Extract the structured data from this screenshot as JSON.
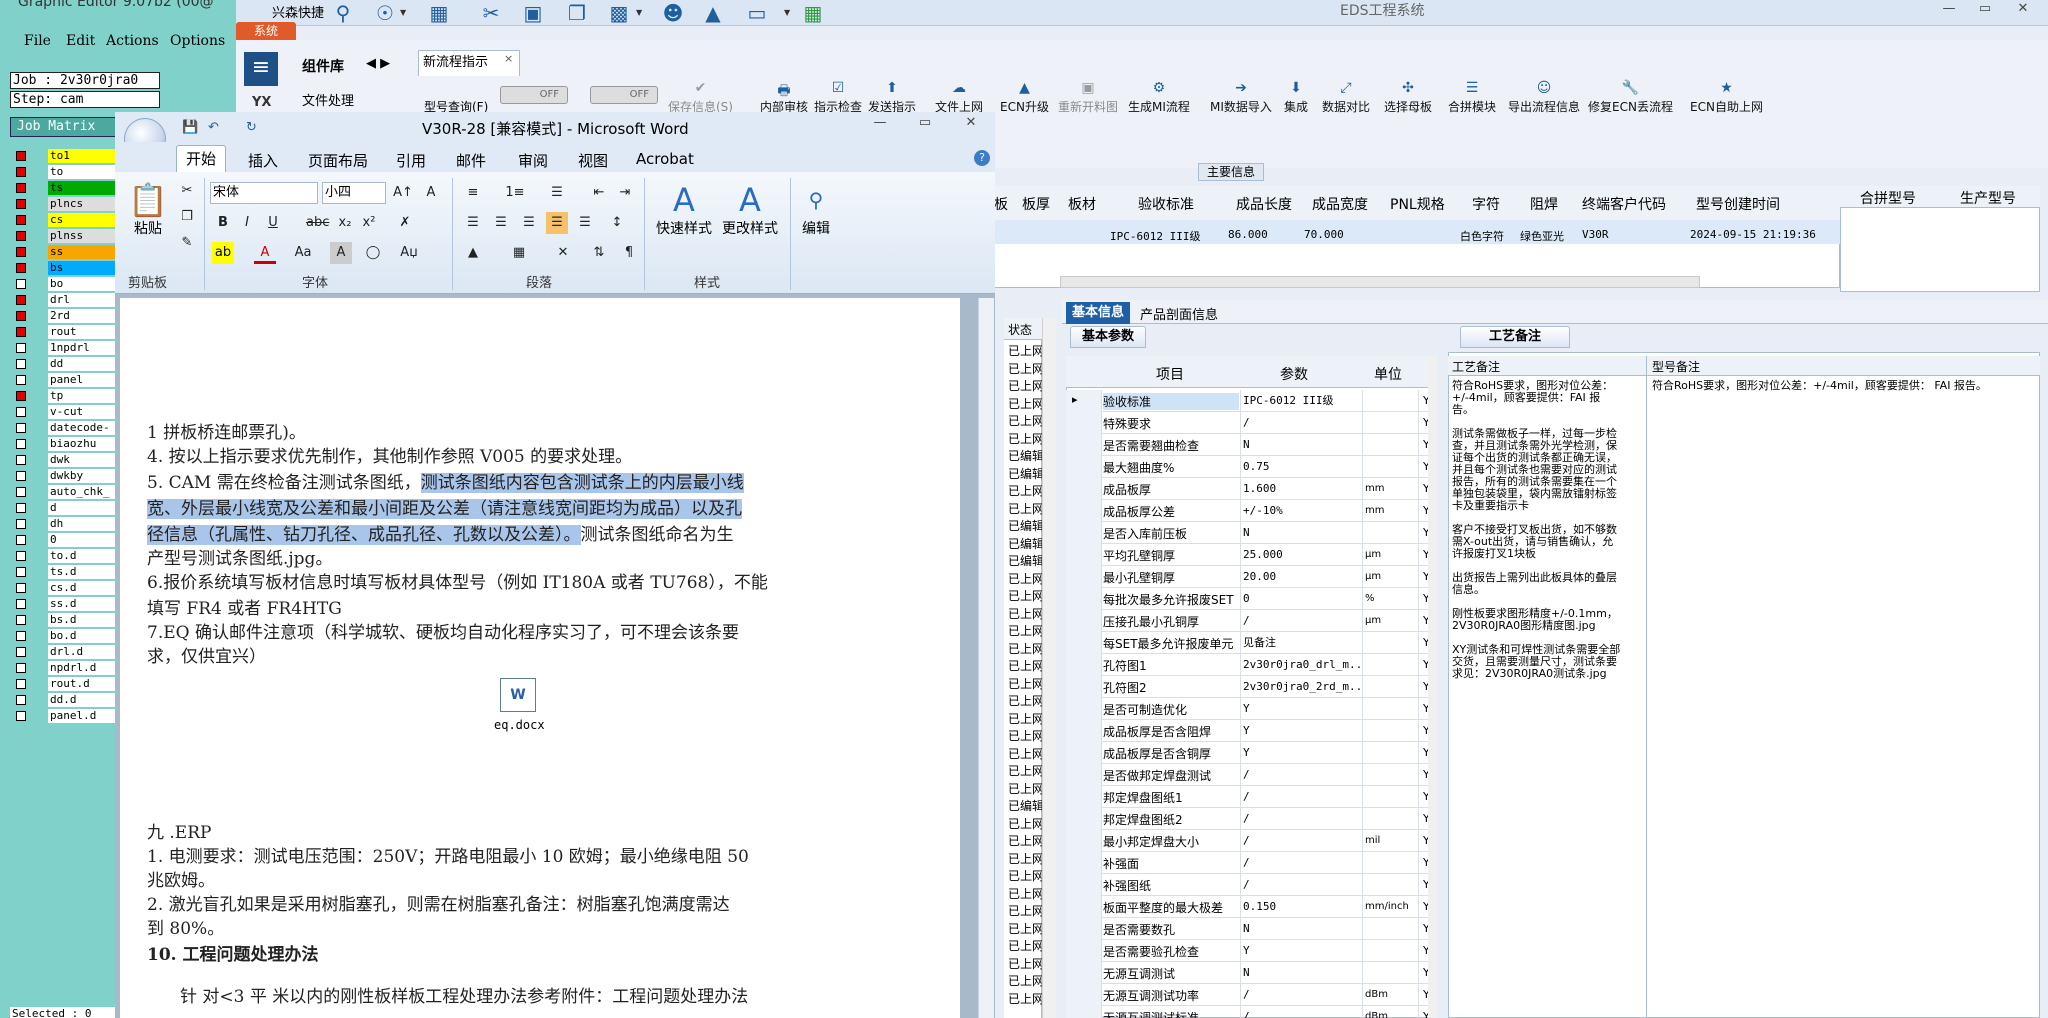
{
  "genesis": {
    "title": "Graphic Editor 9.07b2 (00@",
    "menus": [
      "File",
      "Edit",
      "Actions",
      "Options"
    ],
    "job_label": "Job : 2v30r0jra0",
    "step_label": "Step: cam",
    "matrix_label": "Job Matrix",
    "layers": [
      {
        "name": "to1",
        "on": true
      },
      {
        "name": "to",
        "on": true
      },
      {
        "name": "ts",
        "on": true
      },
      {
        "name": "plncs",
        "on": true
      },
      {
        "name": "cs",
        "on": true
      },
      {
        "name": "plnss",
        "on": true
      },
      {
        "name": "ss",
        "on": true
      },
      {
        "name": "bs",
        "on": true
      },
      {
        "name": "bo",
        "on": false
      },
      {
        "name": "drl",
        "on": true
      },
      {
        "name": "2rd",
        "on": true
      },
      {
        "name": "rout",
        "on": true
      },
      {
        "name": "1npdrl",
        "on": false
      },
      {
        "name": "dd",
        "on": false
      },
      {
        "name": "panel",
        "on": false
      },
      {
        "name": "tp",
        "on": true
      },
      {
        "name": "v-cut",
        "on": false
      },
      {
        "name": "datecode-",
        "on": false
      },
      {
        "name": "biaozhu",
        "on": false
      },
      {
        "name": "dwk",
        "on": false
      },
      {
        "name": "dwkby",
        "on": false
      },
      {
        "name": "auto_chk_",
        "on": false
      },
      {
        "name": "d",
        "on": false
      },
      {
        "name": "dh",
        "on": false
      },
      {
        "name": "0",
        "on": false
      },
      {
        "name": "to.d",
        "on": false
      },
      {
        "name": "ts.d",
        "on": false
      },
      {
        "name": "cs.d",
        "on": false
      },
      {
        "name": "ss.d",
        "on": false
      },
      {
        "name": "bs.d",
        "on": false
      },
      {
        "name": "bo.d",
        "on": false
      },
      {
        "name": "drl.d",
        "on": false
      },
      {
        "name": "npdrl.d",
        "on": false
      },
      {
        "name": "rout.d",
        "on": false
      },
      {
        "name": "dd.d",
        "on": false
      },
      {
        "name": "panel.d",
        "on": false
      }
    ],
    "selected": "Selected : 0"
  },
  "eds": {
    "title": "EDS工程系统",
    "system_tab": "系统",
    "quick_label": "兴森快捷",
    "window_controls": [
      "—",
      "▭",
      "✕"
    ],
    "component_lib": "组件库",
    "comp_nav": "◀ ▶",
    "file_processing": "文件处理",
    "yx": "YX",
    "menu_icon": "≡",
    "doc_tab": "新流程指示",
    "doc_tab_close": "×",
    "query_btn": "型号查询(F)",
    "toggle1": "OFF",
    "toggle2": "OFF",
    "ribbon_buttons": [
      {
        "label": "保存信息(S)",
        "icon": "✔",
        "disabled": true
      },
      {
        "label": "内部审核",
        "icon": "🖶",
        "disabled": false
      },
      {
        "label": "指示检查",
        "icon": "☑",
        "disabled": false
      },
      {
        "label": "发送指示",
        "icon": "⬆",
        "disabled": false
      },
      {
        "label": "文件上网",
        "icon": "☁",
        "disabled": false
      },
      {
        "label": "ECN升级",
        "icon": "▲",
        "disabled": false
      },
      {
        "label": "重新开料图",
        "icon": "▣",
        "disabled": true
      },
      {
        "label": "生成MI流程",
        "icon": "⚙",
        "disabled": false
      },
      {
        "label": "MI数据导入",
        "icon": "➔",
        "disabled": false
      },
      {
        "label": "集成",
        "icon": "⬇",
        "disabled": false
      },
      {
        "label": "数据对比",
        "icon": "⤢",
        "disabled": false
      },
      {
        "label": "选择母板",
        "icon": "✣",
        "disabled": false
      },
      {
        "label": "合拼模块",
        "icon": "☰",
        "disabled": false
      },
      {
        "label": "导出流程信息",
        "icon": "☺",
        "disabled": false
      },
      {
        "label": "修复ECN丢流程",
        "icon": "🔧",
        "disabled": false
      },
      {
        "label": "ECN自助上网",
        "icon": "★",
        "disabled": false
      }
    ],
    "main_info_label": "主要信息",
    "grid_headers": [
      "板",
      "板厚",
      "板材",
      "验收标准",
      "成品长度",
      "成品宽度",
      "PNL规格",
      "字符",
      "阻焊",
      "终端客户代码",
      "型号创建时间"
    ],
    "grid_row": [
      "",
      "",
      "",
      "IPC-6012 III级",
      "86.000",
      "70.000",
      "",
      "白色字符",
      "绿色亚光",
      "V30R",
      "2024-09-15 21:19:36"
    ],
    "grid_right_headers": [
      "合拼型号",
      "生产型号"
    ],
    "status_header": "状态",
    "status_values": [
      "已上网",
      "已上网",
      "已上网",
      "已上网",
      "已上网",
      "已上网",
      "已编辑",
      "已编辑",
      "已上网",
      "已上网",
      "已编辑",
      "已编辑",
      "已编辑",
      "已上网",
      "已上网",
      "已上网",
      "已上网",
      "已上网",
      "已上网",
      "已上网",
      "已上网",
      "已上网",
      "已上网",
      "已上网",
      "已上网",
      "已上网",
      "已编辑",
      "已上网",
      "已上网",
      "已上网",
      "已上网",
      "已上网",
      "已上网",
      "已上网",
      "已上网",
      "已上网",
      "已上网",
      "已上网"
    ],
    "lower_tabs": [
      "基本信息",
      "产品剖面信息"
    ],
    "sub_tab_basic": "基本参数",
    "sub_tab_craft": "工艺备注",
    "params_headers": [
      "项目",
      "参数",
      "单位"
    ],
    "params": [
      {
        "item": "验收标准",
        "value": "IPC-6012 III级",
        "unit": "",
        "flag": "Y"
      },
      {
        "item": "特殊要求",
        "value": "/",
        "unit": "",
        "flag": "Y"
      },
      {
        "item": "是否需要翘曲检查",
        "value": "N",
        "unit": "",
        "flag": "Y"
      },
      {
        "item": "最大翘曲度%",
        "value": "0.75",
        "unit": "",
        "flag": "Y"
      },
      {
        "item": "成品板厚",
        "value": "1.600",
        "unit": "mm",
        "flag": "Y"
      },
      {
        "item": "成品板厚公差",
        "value": "+/-10%",
        "unit": "mm",
        "flag": "Y"
      },
      {
        "item": "是否入库前压板",
        "value": "N",
        "unit": "",
        "flag": "Y"
      },
      {
        "item": "平均孔壁铜厚",
        "value": "25.000",
        "unit": "μm",
        "flag": "Y"
      },
      {
        "item": "最小孔壁铜厚",
        "value": "20.00",
        "unit": "μm",
        "flag": "Y"
      },
      {
        "item": "每批次最多允许报废SET",
        "value": "0",
        "unit": "%",
        "flag": "Y"
      },
      {
        "item": "压接孔最小孔铜厚",
        "value": "/",
        "unit": "μm",
        "flag": "Y"
      },
      {
        "item": "每SET最多允许报废单元",
        "value": "见备注",
        "unit": "",
        "flag": "Y"
      },
      {
        "item": "孔符图1",
        "value": "2v30r0jra0_drl_m...",
        "unit": "",
        "flag": "Y"
      },
      {
        "item": "孔符图2",
        "value": "2v30r0jra0_2rd_m...",
        "unit": "",
        "flag": "Y"
      },
      {
        "item": "是否可制造优化",
        "value": "Y",
        "unit": "",
        "flag": "Y"
      },
      {
        "item": "成品板厚是否含阻焊",
        "value": "Y",
        "unit": "",
        "flag": "Y"
      },
      {
        "item": "成品板厚是否含铜厚",
        "value": "Y",
        "unit": "",
        "flag": "Y"
      },
      {
        "item": "是否做邦定焊盘测试",
        "value": "/",
        "unit": "",
        "flag": "Y"
      },
      {
        "item": "邦定焊盘图纸1",
        "value": "/",
        "unit": "",
        "flag": "Y"
      },
      {
        "item": "邦定焊盘图纸2",
        "value": "/",
        "unit": "",
        "flag": "Y"
      },
      {
        "item": "最小邦定焊盘大小",
        "value": "/",
        "unit": "mil",
        "flag": "Y"
      },
      {
        "item": "补强面",
        "value": "/",
        "unit": "",
        "flag": "Y"
      },
      {
        "item": "补强图纸",
        "value": "/",
        "unit": "",
        "flag": "Y"
      },
      {
        "item": "板面平整度的最大极差",
        "value": "0.150",
        "unit": "mm/inch",
        "flag": "Y"
      },
      {
        "item": "是否需要数孔",
        "value": "N",
        "unit": "",
        "flag": "Y"
      },
      {
        "item": "是否需要验孔检查",
        "value": "Y",
        "unit": "",
        "flag": "Y"
      },
      {
        "item": "无源互调测试",
        "value": "N",
        "unit": "",
        "flag": "Y"
      },
      {
        "item": "无源互调测试功率",
        "value": "/",
        "unit": "dBm",
        "flag": "Y"
      },
      {
        "item": "无源互调测试标准",
        "value": "/",
        "unit": "dBm",
        "flag": "Y"
      }
    ],
    "craft_headers": [
      "工艺备注",
      "型号备注"
    ],
    "craft_text1": "符合RoHS要求，图形对位公差：+/-4mil，顾客要提供：FAI 报告。\n\n测试条需做板子一样，过每一步检查，并且测试条需外光学检测，保证每个出货的测试条都正确无误，并且每个测试条也需要对应的测试报告，所有的测试条需要集在一个单独包装袋里，袋内需放镭射标签卡及重要指示卡\n\n客户不接受打叉板出货，如不够数需X-out出货，请与销售确认，允许报废打叉1块板\n\n出货报告上需列出此板具体的叠层信息。\n\n刚性板要求图形精度+/-0.1mm，2V30R0JRA0图形精度图.jpg\n\nXY测试条和可焊性测试条需要全部交货，且需要测量尺寸，测试条要求见：2V30R0JRA0测试条.jpg",
    "craft_text2": "符合RoHS要求，图形对位公差：+/-4mil，顾客要提供： FAI 报告。"
  },
  "word": {
    "title": "V30R-28 [兼容模式] - Microsoft Word",
    "window_controls": [
      "—",
      "▭",
      "✕"
    ],
    "tabs": [
      "开始",
      "插入",
      "页面布局",
      "引用",
      "邮件",
      "审阅",
      "视图",
      "Acrobat"
    ],
    "font_name": "宋体",
    "font_size": "小四",
    "group_labels": [
      "剪贴板",
      "字体",
      "段落",
      "样式",
      "编辑"
    ],
    "paste_label": "粘贴",
    "quick_styles": "快速样式",
    "change_styles": "更改样式",
    "edit_label": "编辑",
    "attachment": "eq.docx",
    "doc_lines": [
      {
        "text": "1 拼板桥连邮票孔)。",
        "hl": ""
      },
      {
        "text": "4. 按以上指示要求优先制作，其他制作参照 V005 的要求处理。",
        "hl": ""
      },
      {
        "pre": "5. CAM 需在终检备注测试条图纸，",
        "hl": "测试条图纸内容包含测试条上的内层最小线"
      },
      {
        "pre": "",
        "hl": "宽、外层最小线宽及公差和最小间距及公差（请注意线宽间距均为成品）以及孔"
      },
      {
        "pre": "",
        "hl": "径信息（孔属性、钻刀孔径、成品孔径、孔数以及公差）。",
        "post": "测试条图纸命名为生"
      },
      {
        "text": "产型号测试条图纸.jpg。",
        "hl": ""
      },
      {
        "text": "6.报价系统填写板材信息时填写板材具体型号（例如 IT180A 或者 TU768），不能",
        "hl": ""
      },
      {
        "text": "填写 FR4 或者 FR4HTG",
        "hl": ""
      },
      {
        "text": "7.EQ 确认邮件注意项（科学城软、硬板均自动化程序实习了，可不理会该条要",
        "hl": ""
      },
      {
        "text": "求，仅供宜兴）",
        "hl": ""
      },
      {
        "text": "九 .ERP",
        "hl": ""
      },
      {
        "text": "1. 电测要求：测试电压范围：250V；开路电阻最小 10 欧姆；最小绝缘电阻 50",
        "hl": ""
      },
      {
        "text": "兆欧姆。",
        "hl": ""
      },
      {
        "text": "2. 激光盲孔如果是采用树脂塞孔，则需在树脂塞孔备注：树脂塞孔饱满度需达",
        "hl": ""
      },
      {
        "text": "到 80%。",
        "hl": ""
      },
      {
        "text": "10. 工程问题处理办法",
        "hl": ""
      },
      {
        "text": "针 对<3 平 米以内的刚性板样板工程处理办法参考附件：工程问题处理办法",
        "hl": ""
      }
    ]
  },
  "colors": {
    "genesis_bg": "#7fd1c9",
    "eds_accent": "#1f5fa6",
    "highlight": "#a9c6ea"
  }
}
